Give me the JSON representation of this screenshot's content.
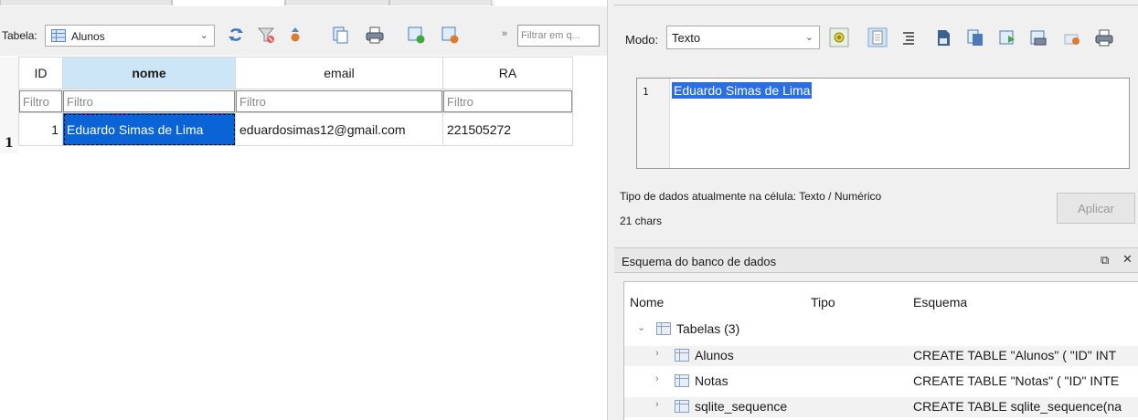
{
  "left": {
    "table_label": "Tabela:",
    "table_value": "Alunos",
    "filter_placeholder": "Filtrar em q...",
    "filter_chevrons": "»",
    "grid": {
      "columns": [
        "ID",
        "nome",
        "email",
        "RA"
      ],
      "filter_placeholder": "Filtro",
      "rows": [
        {
          "row_number": "1",
          "id": "1",
          "nome": "Eduardo Simas de Lima",
          "email": "eduardosimas12@gmail.com",
          "ra": "221505272"
        }
      ]
    }
  },
  "right": {
    "mode_label": "Modo:",
    "mode_value": "Texto",
    "editor": {
      "line_number": "1",
      "text": "Eduardo Simas de Lima"
    },
    "type_info": "Tipo de dados atualmente na célula: Texto / Numérico",
    "char_count": "21 chars",
    "apply_label": "Aplicar",
    "schema": {
      "title": "Esquema do banco de dados",
      "columns": [
        "Nome",
        "Tipo",
        "Esquema"
      ],
      "group_label": "Tabelas (3)",
      "tables": [
        {
          "name": "Alunos",
          "schema": "CREATE TABLE \"Alunos\" ( \"ID\" INT"
        },
        {
          "name": "Notas",
          "schema": "CREATE TABLE \"Notas\" ( \"ID\" INTE"
        },
        {
          "name": "sqlite_sequence",
          "schema": "CREATE TABLE sqlite_sequence(na"
        }
      ]
    }
  },
  "colors": {
    "selection": "#0a64d6",
    "selected_header": "#cde6f7"
  }
}
